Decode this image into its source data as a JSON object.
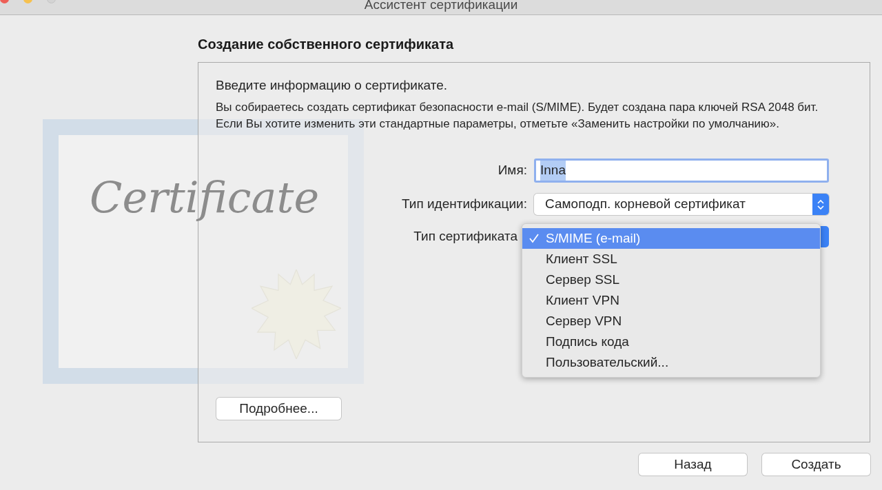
{
  "window": {
    "title": "Ассистент сертификации"
  },
  "heading": "Создание собственного сертификата",
  "artwork": {
    "caption": "Certificate"
  },
  "intro": "Введите информацию о сертификате.",
  "description": "Вы собираетесь создать сертификат безопасности e-mail (S/MIME). Будет создана пара ключей RSA 2048 бит. Если Вы хотите изменить эти стандартные параметры, отметьте «Заменить настройки по умолчанию».",
  "form": {
    "name": {
      "label": "Имя:",
      "value": "Inna"
    },
    "identity_type": {
      "label": "Тип идентификации:",
      "value": "Самоподп. корневой сертификат"
    },
    "certificate_type": {
      "label": "Тип сертификата",
      "menu": [
        {
          "label": "S/MIME (e-mail)",
          "selected": true
        },
        {
          "label": "Клиент SSL",
          "selected": false
        },
        {
          "label": "Сервер SSL",
          "selected": false
        },
        {
          "label": "Клиент VPN",
          "selected": false
        },
        {
          "label": "Сервер VPN",
          "selected": false
        },
        {
          "label": "Подпись кода",
          "selected": false
        },
        {
          "label": "Пользовательский...",
          "selected": false
        }
      ]
    }
  },
  "details_button": "Подробнее...",
  "buttons": [
    "Назад",
    "Создать"
  ]
}
